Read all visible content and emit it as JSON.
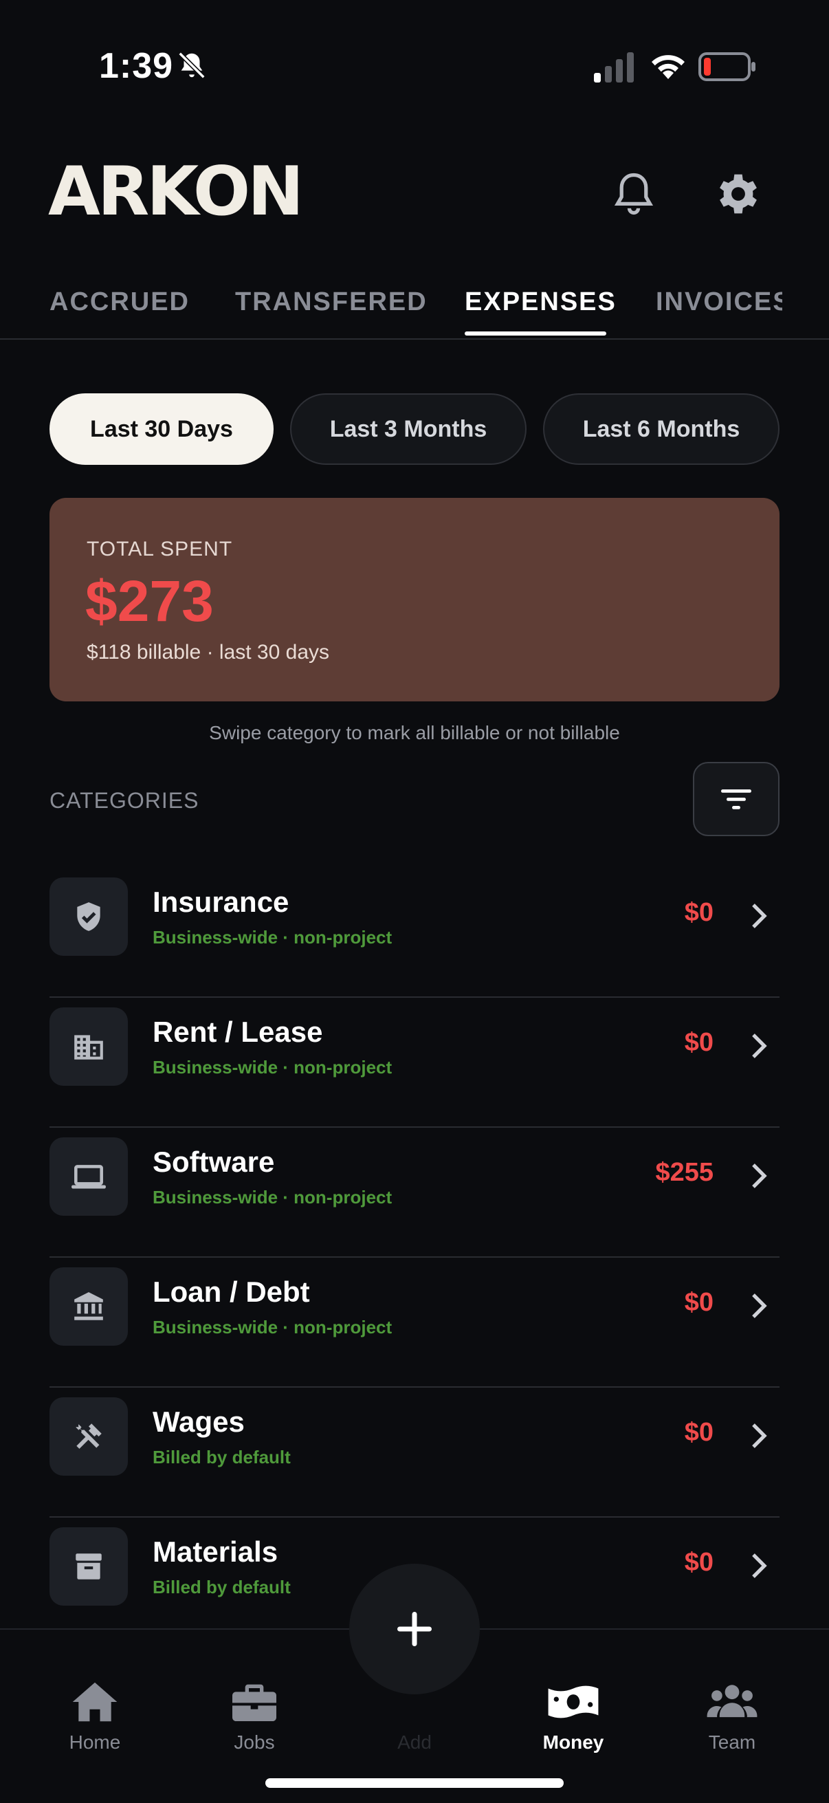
{
  "status": {
    "time": "1:39"
  },
  "header": {
    "logo": "ARKON"
  },
  "tabs": [
    {
      "label": "ACCRUED"
    },
    {
      "label": "TRANSFERED"
    },
    {
      "label": "EXPENSES"
    },
    {
      "label": "INVOICES"
    }
  ],
  "periods": [
    {
      "label": "Last 30 Days"
    },
    {
      "label": "Last 3 Months"
    },
    {
      "label": "Last 6 Months"
    }
  ],
  "summary": {
    "label": "TOTAL SPENT",
    "amount": "$273",
    "sub": "$118 billable · last 30 days"
  },
  "hint": "Swipe category to mark all billable or not billable",
  "categories_title": "CATEGORIES",
  "categories": [
    {
      "name": "Insurance",
      "sub": "Business-wide · non-project",
      "amount": "$0",
      "icon": "shield-check-icon"
    },
    {
      "name": "Rent / Lease",
      "sub": "Business-wide · non-project",
      "amount": "$0",
      "icon": "building-icon"
    },
    {
      "name": "Software",
      "sub": "Business-wide · non-project",
      "amount": "$255",
      "icon": "laptop-icon"
    },
    {
      "name": "Loan / Debt",
      "sub": "Business-wide · non-project",
      "amount": "$0",
      "icon": "bank-icon"
    },
    {
      "name": "Wages",
      "sub": "Billed by default",
      "amount": "$0",
      "icon": "tools-icon"
    },
    {
      "name": "Materials",
      "sub": "Billed by default",
      "amount": "$0",
      "icon": "archive-box-icon"
    }
  ],
  "nav": [
    {
      "label": "Home",
      "icon": "home-icon"
    },
    {
      "label": "Jobs",
      "icon": "briefcase-icon"
    },
    {
      "label": "Add",
      "icon": "plus-icon"
    },
    {
      "label": "Money",
      "icon": "money-icon"
    },
    {
      "label": "Team",
      "icon": "team-icon"
    }
  ],
  "colors": {
    "accent_red": "#f04b4b",
    "sub_green": "#4f9a3b",
    "card_bg": "#5e3d35",
    "background": "#0b0c0f"
  }
}
